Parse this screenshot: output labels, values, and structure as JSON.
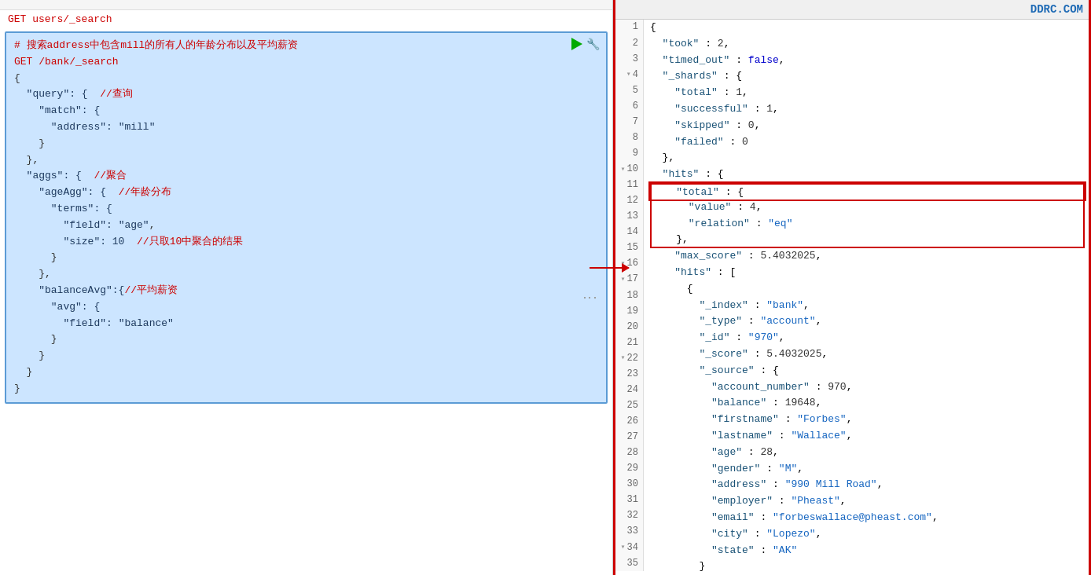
{
  "brand": "DDRC.COM",
  "left": {
    "get_line_1": "GET users/_search",
    "comment_block": "# 搜索address中包含mill的所有人的年龄分布以及平均薪资",
    "get_line_2": "GET /bank/_search",
    "code_lines": [
      "{",
      "  \"query\": {  //查询",
      "    \"match\": {",
      "      \"address\": \"mill\"",
      "    }",
      "  },",
      "  \"aggs\": {  //聚合",
      "    \"ageAgg\": {  //年龄分布",
      "      \"terms\": {",
      "        \"field\": \"age\",",
      "        \"size\": 10  //只取10中聚合的结果",
      "      }",
      "    },",
      "    \"balanceAvg\":{//平均薪资",
      "      \"avg\": {",
      "        \"field\": \"balance\"",
      "      }",
      "    }",
      "  }",
      "}"
    ]
  },
  "right": {
    "lines": [
      {
        "num": "1",
        "arrow": "",
        "content": "{"
      },
      {
        "num": "2",
        "arrow": "",
        "content": "  \"took\" : 2,"
      },
      {
        "num": "3",
        "arrow": "",
        "content": "  \"timed_out\" : false,"
      },
      {
        "num": "4",
        "arrow": "▾",
        "content": "  \"_shards\" : {"
      },
      {
        "num": "5",
        "arrow": "",
        "content": "    \"total\" : 1,"
      },
      {
        "num": "6",
        "arrow": "",
        "content": "    \"successful\" : 1,"
      },
      {
        "num": "7",
        "arrow": "",
        "content": "    \"skipped\" : 0,"
      },
      {
        "num": "8",
        "arrow": "",
        "content": "    \"failed\" : 0"
      },
      {
        "num": "9",
        "arrow": "",
        "content": "  },"
      },
      {
        "num": "10",
        "arrow": "▾",
        "content": "  \"hits\" : {"
      },
      {
        "num": "11",
        "arrow": "",
        "content": "    \"total\" : {",
        "highlight_start": true
      },
      {
        "num": "12",
        "arrow": "",
        "content": "      \"value\" : 4,",
        "highlight": true
      },
      {
        "num": "13",
        "arrow": "",
        "content": "      \"relation\" : \"eq\"",
        "highlight": true
      },
      {
        "num": "14",
        "arrow": "",
        "content": "    },",
        "highlight_end": true
      },
      {
        "num": "15",
        "arrow": "",
        "content": "    \"max_score\" : 5.4032025,"
      },
      {
        "num": "16",
        "arrow": "▾",
        "content": "    \"hits\" : ["
      },
      {
        "num": "17",
        "arrow": "▾",
        "content": "      {"
      },
      {
        "num": "18",
        "arrow": "",
        "content": "        \"_index\" : \"bank\","
      },
      {
        "num": "19",
        "arrow": "",
        "content": "        \"_type\" : \"account\","
      },
      {
        "num": "20",
        "arrow": "",
        "content": "        \"_id\" : \"970\","
      },
      {
        "num": "21",
        "arrow": "",
        "content": "        \"_score\" : 5.4032025,"
      },
      {
        "num": "22",
        "arrow": "▾",
        "content": "        \"_source\" : {"
      },
      {
        "num": "23",
        "arrow": "",
        "content": "          \"account_number\" : 970,"
      },
      {
        "num": "24",
        "arrow": "",
        "content": "          \"balance\" : 19648,"
      },
      {
        "num": "25",
        "arrow": "",
        "content": "          \"firstname\" : \"Forbes\","
      },
      {
        "num": "26",
        "arrow": "",
        "content": "          \"lastname\" : \"Wallace\","
      },
      {
        "num": "27",
        "arrow": "",
        "content": "          \"age\" : 28,"
      },
      {
        "num": "28",
        "arrow": "",
        "content": "          \"gender\" : \"M\","
      },
      {
        "num": "29",
        "arrow": "",
        "content": "          \"address\" : \"990 Mill Road\","
      },
      {
        "num": "30",
        "arrow": "",
        "content": "          \"employer\" : \"Pheast\","
      },
      {
        "num": "31",
        "arrow": "",
        "content": "          \"email\" : \"forbeswallace@pheast.com\","
      },
      {
        "num": "32",
        "arrow": "",
        "content": "          \"city\" : \"Lopezo\","
      },
      {
        "num": "33",
        "arrow": "",
        "content": "          \"state\" : \"AK\""
      },
      {
        "num": "34",
        "arrow": "▾",
        "content": "        }"
      },
      {
        "num": "35",
        "arrow": "",
        "content": "      ..."
      }
    ]
  }
}
